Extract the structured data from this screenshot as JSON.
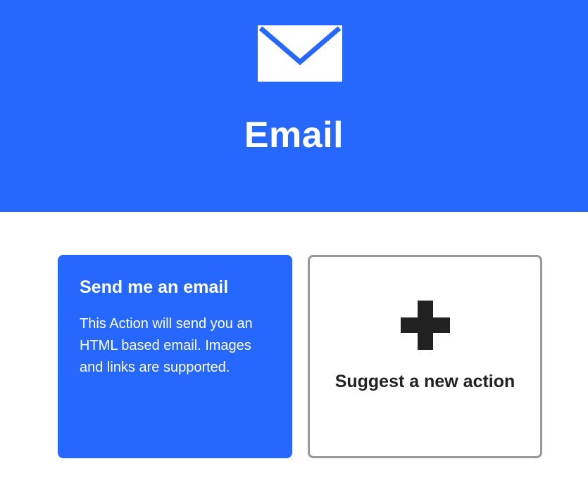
{
  "header": {
    "icon": "envelope-icon",
    "title": "Email",
    "background_color": "#2667fe"
  },
  "actions": [
    {
      "title": "Send me an email",
      "description": "This Action will send you an HTML based email. Images and links are supported.",
      "background_color": "#2667fe"
    }
  ],
  "suggest": {
    "icon": "plus-icon",
    "label": "Suggest a new action",
    "border_color": "#999999"
  }
}
